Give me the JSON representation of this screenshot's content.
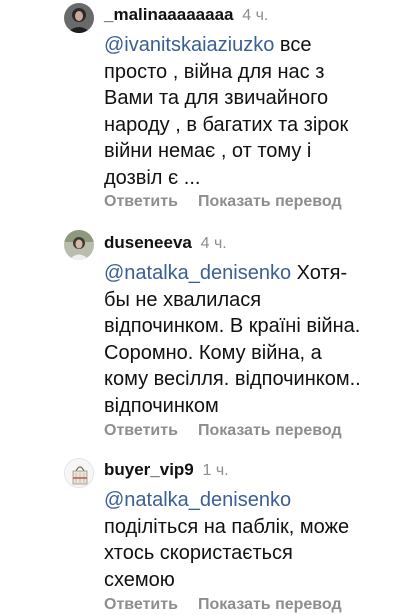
{
  "comments": [
    {
      "username": "_malinaaaaaaaa",
      "time": "4 ч.",
      "avatar_icon": "profile-photo",
      "lines": [
        {
          "mention": "@ivanitskaiaziuzko",
          "text": " все"
        },
        {
          "mention": "",
          "text": "просто , війна для нас з"
        },
        {
          "mention": "",
          "text": "Вами та для звичайного"
        },
        {
          "mention": "",
          "text": "народу , в багатих та зірок"
        },
        {
          "mention": "",
          "text": "війни немає , от тому і"
        },
        {
          "mention": "",
          "text": "дозвіл є ..."
        }
      ],
      "reply_label": "Ответить",
      "translate_label": "Показать перевод"
    },
    {
      "username": "duseneeva",
      "time": "4 ч.",
      "avatar_icon": "profile-photo",
      "lines": [
        {
          "mention": "@natalka_denisenko",
          "text": " Хотя-"
        },
        {
          "mention": "",
          "text": "бы  не хвалилася"
        },
        {
          "mention": "",
          "text": "відпочинком. В країні війна."
        },
        {
          "mention": "",
          "text": "Соромно. Кому війна, а"
        },
        {
          "mention": "",
          "text": "кому весілля. відпочинком.."
        },
        {
          "mention": "",
          "text": "відпочинком"
        }
      ],
      "reply_label": "Ответить",
      "translate_label": "Показать перевод"
    },
    {
      "username": "buyer_vip9",
      "time": "1 ч.",
      "avatar_icon": "handbag-photo",
      "lines": [
        {
          "mention": "@natalka_denisenko",
          "text": ""
        },
        {
          "mention": "",
          "text": "поділіться на паблік, може"
        },
        {
          "mention": "",
          "text": "хтось скористається"
        },
        {
          "mention": "",
          "text": "схемою"
        }
      ],
      "reply_label": "Ответить",
      "translate_label": "Показать перевод"
    }
  ]
}
